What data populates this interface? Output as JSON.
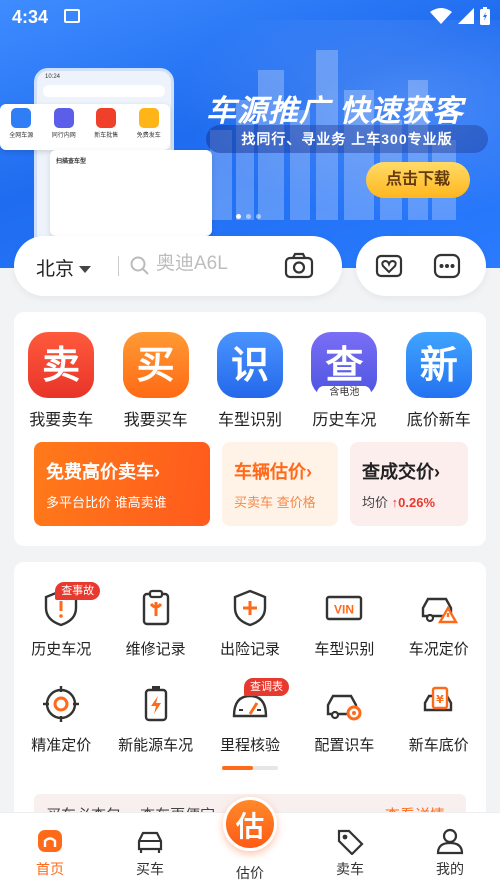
{
  "status_bar": {
    "time": "4:34"
  },
  "banner": {
    "headline": "车源推广 快速获客",
    "subline": "找同行、寻业务  上车300专业版",
    "download_button": "点击下载",
    "mock_tiles": [
      "全网车源",
      "同行内网",
      "新车批售",
      "免费发车"
    ],
    "mock_card_title": "扫描查车型"
  },
  "search": {
    "city": "北京",
    "placeholder": "奥迪A6L"
  },
  "quick_actions": [
    {
      "label": "我要卖车",
      "glyph": "卖",
      "color": "#f0402a",
      "icon": "sell-icon"
    },
    {
      "label": "我要买车",
      "glyph": "买",
      "color": "#ff7a1a",
      "icon": "buy-icon"
    },
    {
      "label": "车型识别",
      "glyph": "识",
      "color": "#2f7ef5",
      "icon": "identify-icon"
    },
    {
      "label": "历史车况",
      "glyph": "查",
      "color": "#5a5ee8",
      "icon": "history-icon",
      "tag": "含电池"
    },
    {
      "label": "底价新车",
      "glyph": "新",
      "color": "#2f8cf5",
      "icon": "new-car-icon"
    }
  ],
  "promos": [
    {
      "title": "免费高价卖车›",
      "sub": "多平台比价 谁高卖谁"
    },
    {
      "title": "车辆估价›",
      "sub": "买卖车 查价格"
    },
    {
      "title": "查成交价›",
      "sub_prefix": "均价",
      "sub_value": "↑0.26%"
    }
  ],
  "tools": [
    {
      "label": "历史车况",
      "icon": "shield-alert-icon",
      "badge": "查事故"
    },
    {
      "label": "维修记录",
      "icon": "wrench-clipboard-icon"
    },
    {
      "label": "出险记录",
      "icon": "shield-plus-icon"
    },
    {
      "label": "车型识别",
      "icon": "vin-icon",
      "text": "VIN"
    },
    {
      "label": "车况定价",
      "icon": "car-warning-icon"
    },
    {
      "label": "精准定价",
      "icon": "target-icon"
    },
    {
      "label": "新能源车况",
      "icon": "battery-icon"
    },
    {
      "label": "里程核验",
      "icon": "odometer-icon",
      "badge": "查调表"
    },
    {
      "label": "配置识车",
      "icon": "car-gear-icon"
    },
    {
      "label": "新车底价",
      "icon": "price-tag-icon"
    }
  ],
  "tools_scroll_progress": 0.55,
  "peek": {
    "text": "买车必查包 一查车更便宜",
    "link": "查看详情 ›"
  },
  "tabs": [
    {
      "label": "首页",
      "icon": "home-icon",
      "active": true
    },
    {
      "label": "买车",
      "icon": "car-icon"
    },
    {
      "label": "估价",
      "icon": "estimate-icon",
      "glyph": "估"
    },
    {
      "label": "卖车",
      "icon": "tag-icon"
    },
    {
      "label": "我的",
      "icon": "user-icon"
    }
  ],
  "colors": {
    "accent": "#ff6a1a",
    "brand_blue": "#1f6cf0",
    "alert_red": "#e8392f"
  }
}
